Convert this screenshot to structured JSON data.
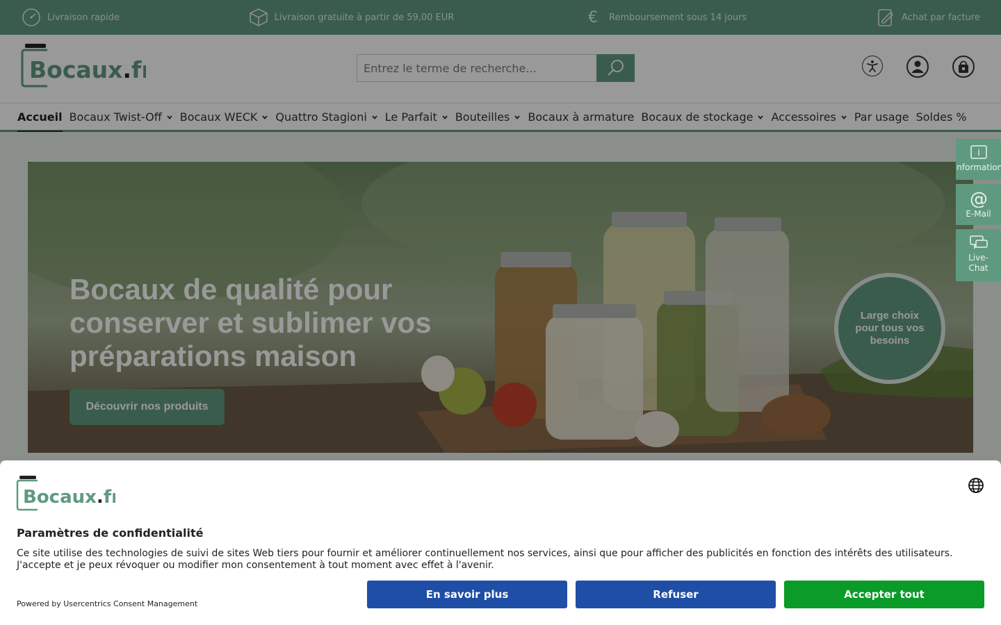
{
  "colors": {
    "brand_green": "#5f9a80",
    "consent_blue": "#1f4ea6",
    "consent_green": "#0a9b28"
  },
  "topbar": {
    "items": [
      {
        "icon": "speedometer-icon",
        "label": "Livraison rapide"
      },
      {
        "icon": "package-icon",
        "label": "Livraison gratuite à partir de 59,00 EUR"
      },
      {
        "icon": "euro-icon",
        "label": "Remboursement sous 14 jours"
      },
      {
        "icon": "invoice-icon",
        "label": "Achat par facture"
      }
    ]
  },
  "header": {
    "logo_text": "Bocaux.fr",
    "search": {
      "placeholder": "Entrez le terme de recherche..."
    },
    "actions": [
      {
        "icon": "accessibility-icon"
      },
      {
        "icon": "account-icon"
      },
      {
        "icon": "cart-icon"
      }
    ]
  },
  "nav": {
    "items": [
      {
        "label": "Accueil",
        "active": true,
        "dropdown": false
      },
      {
        "label": "Bocaux Twist-Off",
        "dropdown": true
      },
      {
        "label": "Bocaux WECK",
        "dropdown": true
      },
      {
        "label": "Quattro Stagioni",
        "dropdown": true
      },
      {
        "label": "Le Parfait",
        "dropdown": true
      },
      {
        "label": "Bouteilles",
        "dropdown": true
      },
      {
        "label": "Bocaux à armature",
        "dropdown": false
      },
      {
        "label": "Bocaux de stockage",
        "dropdown": true
      },
      {
        "label": "Accessoires",
        "dropdown": true
      },
      {
        "label": "Par usage",
        "dropdown": false
      },
      {
        "label": "Soldes %",
        "dropdown": false
      }
    ]
  },
  "hero": {
    "title": "Bocaux de qualité pour conserver et sublimer vos préparations maison",
    "cta_label": "Découvrir nos produits",
    "badge_text": "Large choix pour tous vos besoins"
  },
  "side_widget": {
    "items": [
      {
        "icon": "info-icon",
        "label": "Information"
      },
      {
        "icon": "at-icon",
        "label": "E-Mail"
      },
      {
        "icon": "chat-icon",
        "label": "Live-Chat"
      }
    ]
  },
  "consent": {
    "logo_text": "Bocaux.fr",
    "title": "Paramètres de confidentialité",
    "text": "Ce site utilise des technologies de suivi de sites Web tiers pour fournir et améliorer continuellement nos services, ainsi que pour afficher des publicités en fonction des intérêts des utilisateurs. J'accepte et je peux révoquer ou modifier mon consentement à tout moment avec effet à l'avenir.",
    "powered_by": "Powered by Usercentrics Consent Management",
    "buttons": {
      "more": "En savoir plus",
      "deny": "Refuser",
      "accept": "Accepter tout"
    }
  }
}
